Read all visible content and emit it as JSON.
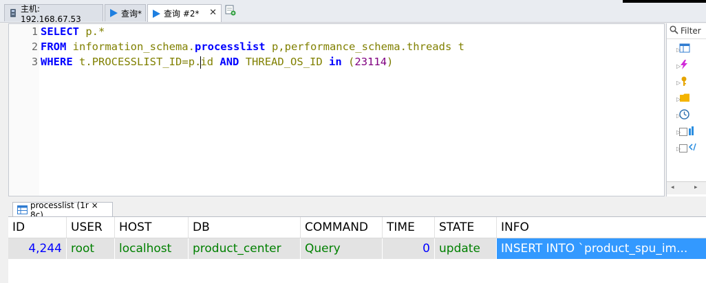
{
  "tabs": [
    {
      "label": "主机: 192.168.67.53",
      "icon": "host-icon"
    },
    {
      "label": "查询*",
      "icon": "query-play-icon"
    },
    {
      "label": "查询 #2*",
      "icon": "query-play-icon",
      "active": true
    }
  ],
  "editor": {
    "line_numbers": [
      "1",
      "2",
      "3"
    ],
    "line1": {
      "kw": "SELECT",
      "expr": " p.*"
    },
    "line2": {
      "kw": "FROM",
      "t1": " information_schema",
      "dot1": ".",
      "t1name": "processlist",
      "alias1": " p,",
      "t2": "performance_schema",
      "dot2": ".",
      "t2name": "threads",
      "alias2": " t"
    },
    "line3": {
      "kw": "WHERE",
      "c1": " t",
      "dot1": ".",
      "c1name": "PROCESSLIST_ID",
      "eq": "=",
      "p": "p",
      "dot2": ".",
      "c2": "id",
      "and": " AND ",
      "c3": "THREAD_OS_ID",
      "in": " in ",
      "paren_open": "(",
      "val": "23114",
      "paren_close": ")"
    }
  },
  "side_panel": {
    "filter_label": "Filter",
    "items": [
      "table-icon",
      "bolt-icon",
      "key-icon",
      "folder-icon",
      "clock-icon",
      "chart-icon",
      "code-icon"
    ]
  },
  "results": {
    "tab_label": "processlist (1r × 8c)",
    "columns": [
      "ID",
      "USER",
      "HOST",
      "DB",
      "COMMAND",
      "TIME",
      "STATE",
      "INFO"
    ],
    "rows": [
      [
        "4,244",
        "root",
        "localhost",
        "product_center",
        "Query",
        "0",
        "update",
        "INSERT INTO `product_spu_im..."
      ]
    ]
  },
  "colors": {
    "keyword": "#0000ff",
    "identifier": "#808000",
    "number": "#800080",
    "cell_text": "#008000",
    "selection": "#3399ff"
  }
}
